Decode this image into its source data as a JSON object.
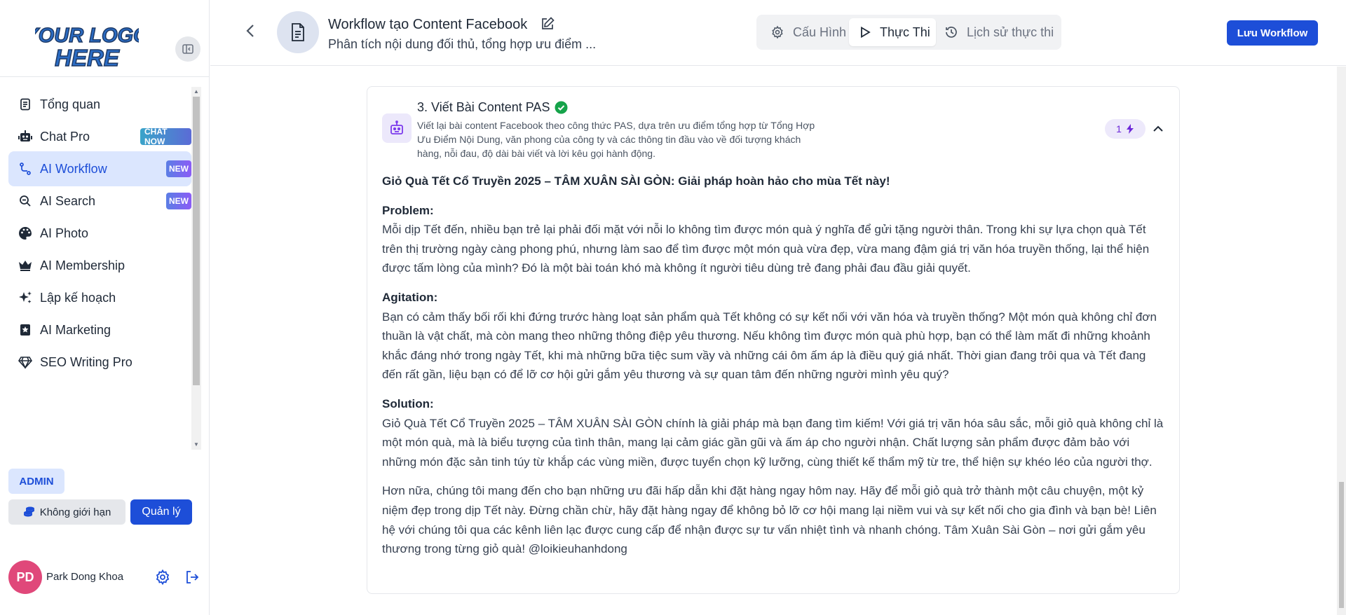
{
  "logo": {
    "line1": "YOUR LOGO",
    "line2": "HERE"
  },
  "sidebar": {
    "items": [
      {
        "label": "Tổng quan",
        "icon": "document-icon",
        "badge": ""
      },
      {
        "label": "Chat Pro",
        "icon": "robot-icon",
        "badge": "CHAT NOW"
      },
      {
        "label": "AI Workflow",
        "icon": "workflow-icon",
        "badge": "NEW",
        "active": true
      },
      {
        "label": "AI Search",
        "icon": "search-icon",
        "badge": "NEW"
      },
      {
        "label": "AI Photo",
        "icon": "palette-icon",
        "badge": ""
      },
      {
        "label": "AI Membership",
        "icon": "crown-icon",
        "badge": ""
      },
      {
        "label": "Lập kế hoạch",
        "icon": "sparkles-icon",
        "badge": ""
      },
      {
        "label": "AI Marketing",
        "icon": "star-book-icon",
        "badge": ""
      },
      {
        "label": "SEO Writing Pro",
        "icon": "diamond-icon",
        "badge": ""
      }
    ],
    "role_badge": "ADMIN",
    "unlimited_label": "Không giới hạn",
    "manage_label": "Quản lý",
    "user": {
      "initials": "PD",
      "name": "Park Dong Khoa",
      "avatar_color": "#e0487a"
    }
  },
  "header": {
    "title": "Workflow tạo Content Facebook",
    "description": "Phân tích nội dung đối thủ, tổng hợp ưu điểm ...",
    "tabs": [
      {
        "label": "Cấu Hình",
        "icon": "gear-icon"
      },
      {
        "label": "Thực Thi",
        "icon": "play-icon",
        "active": true
      },
      {
        "label": "Lịch sử thực thi",
        "icon": "history-icon"
      }
    ],
    "save_label": "Lưu Workflow"
  },
  "step": {
    "title": "3. Viết Bài Content PAS",
    "status": "completed",
    "description": "Viết lại bài content Facebook theo công thức PAS, dựa trên ưu điểm tổng hợp từ Tổng Hợp Ưu Điểm Nội Dung, văn phong của công ty và các thông tin đầu vào về đối tượng khách hàng, nỗi đau, độ dài bài viết và lời kêu gọi hành động.",
    "run_count": "1"
  },
  "article": {
    "headline": "Giỏ Quà Tết Cổ Truyền 2025 – TÂM XUÂN SÀI GÒN: Giải pháp hoàn hảo cho mùa Tết này!",
    "problem_heading": "Problem:",
    "problem_text": "Mỗi dịp Tết đến, nhiều bạn trẻ lại phải đối mặt với nỗi lo không tìm được món quà ý nghĩa để gửi tặng người thân. Trong khi sự lựa chọn quà Tết trên thị trường ngày càng phong phú, nhưng làm sao để tìm được một món quà vừa đẹp, vừa mang đậm giá trị văn hóa truyền thống, lại thể hiện được tấm lòng của mình? Đó là một bài toán khó mà không ít người tiêu dùng trẻ đang phải đau đầu giải quyết.",
    "agitation_heading": "Agitation:",
    "agitation_text": "Bạn có cảm thấy bối rối khi đứng trước hàng loạt sản phẩm quà Tết không có sự kết nối với văn hóa và truyền thống? Một món quà không chỉ đơn thuần là vật chất, mà còn mang theo những thông điệp yêu thương. Nếu không tìm được món quà phù hợp, bạn có thể làm mất đi những khoảnh khắc đáng nhớ trong ngày Tết, khi mà những bữa tiệc sum vầy và những cái ôm ấm áp là điều quý giá nhất. Thời gian đang trôi qua và Tết đang đến rất gần, liệu bạn có để lỡ cơ hội gửi gắm yêu thương và sự quan tâm đến những người mình yêu quý?",
    "solution_heading": "Solution:",
    "solution_text": "Giỏ Quà Tết Cổ Truyền 2025 – TÂM XUÂN SÀI GÒN chính là giải pháp mà bạn đang tìm kiếm! Với giá trị văn hóa sâu sắc, mỗi giỏ quà không chỉ là một món quà, mà là biểu tượng của tình thân, mang lại cảm giác gần gũi và ấm áp cho người nhận. Chất lượng sản phẩm được đảm bảo với những món đặc sản tinh túy từ khắp các vùng miền, được tuyển chọn kỹ lưỡng, cùng thiết kế thẩm mỹ từ tre, thể hiện sự khéo léo của người thợ.",
    "closing_text": "Hơn nữa, chúng tôi mang đến cho bạn những ưu đãi hấp dẫn khi đặt hàng ngay hôm nay. Hãy để mỗi giỏ quà trở thành một câu chuyện, một kỷ niệm đẹp trong dịp Tết này. Đừng chần chừ, hãy đặt hàng ngay để không bỏ lỡ cơ hội mang lại niềm vui và sự kết nối cho gia đình và bạn bè! Liên hệ với chúng tôi qua các kênh liên lạc được cung cấp để nhận được sự tư vấn nhiệt tình và nhanh chóng. Tâm Xuân Sài Gòn – nơi gửi gắm yêu thương trong từng giỏ quà! @loikieuhanhdong"
  },
  "colors": {
    "primary": "#1d4ed8",
    "active_bg": "#dbe6fe",
    "success": "#16a34a",
    "accent_purple": "#6d28d9"
  }
}
